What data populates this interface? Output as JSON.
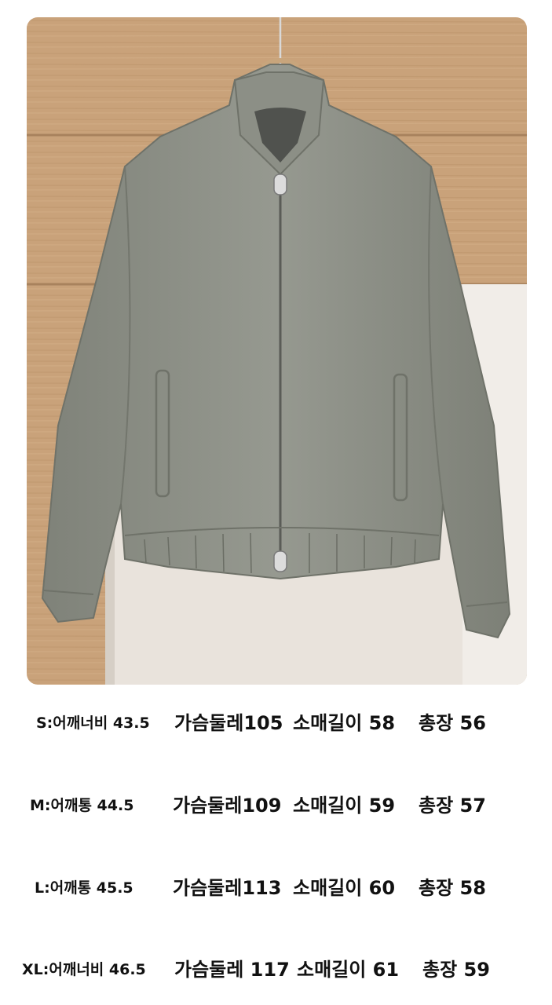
{
  "image": {
    "subject": "jacket-photo",
    "colors": {
      "wood": "#c9a27a",
      "wall": "#e9e3dc",
      "jacket": "#8f9289"
    }
  },
  "sizes": [
    {
      "shoulder": "S:어깨너비 43.5",
      "chest": "가슴둘레105",
      "sleeve": "소매길이 58",
      "length": "총장 56"
    },
    {
      "shoulder": "M:어깨통 44.5",
      "chest": "가슴둘레109",
      "sleeve": "소매길이 59",
      "length": "총장 57"
    },
    {
      "shoulder": "L:어깨통 45.5",
      "chest": "가슴둘레113",
      "sleeve": "소매길이 60",
      "length": "총장 58"
    },
    {
      "shoulder": "XL:어깨너비 46.5",
      "chest": "가슴둘레 117",
      "sleeve": "소매길이 61",
      "length": "총장 59"
    }
  ]
}
